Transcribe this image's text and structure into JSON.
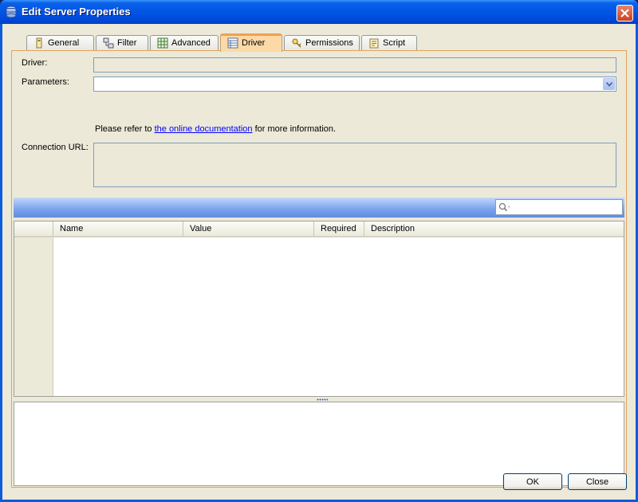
{
  "window": {
    "title": "Edit Server Properties"
  },
  "tabs": [
    {
      "label": "General",
      "icon": "general-icon"
    },
    {
      "label": "Filter",
      "icon": "filter-icon"
    },
    {
      "label": "Advanced",
      "icon": "advanced-icon"
    },
    {
      "label": "Driver",
      "icon": "driver-icon",
      "active": true
    },
    {
      "label": "Permissions",
      "icon": "permissions-icon"
    },
    {
      "label": "Script",
      "icon": "script-icon"
    }
  ],
  "form": {
    "driver_label": "Driver:",
    "driver_value": "",
    "parameters_label": "Parameters:",
    "parameters_value": "",
    "info_prefix": "Please refer to ",
    "info_link": "the online documentation",
    "info_suffix": " for more information.",
    "connection_url_label": "Connection URL:",
    "connection_url_value": ""
  },
  "search": {
    "placeholder": ""
  },
  "grid": {
    "columns": [
      "Name",
      "Value",
      "Required",
      "Description"
    ],
    "rows": []
  },
  "buttons": {
    "ok": "OK",
    "close": "Close"
  },
  "colors": {
    "active_tab": "#fcd9a6",
    "panel_border": "#e3a35b",
    "titlebar": "#0055e5",
    "link": "#0000ff"
  }
}
